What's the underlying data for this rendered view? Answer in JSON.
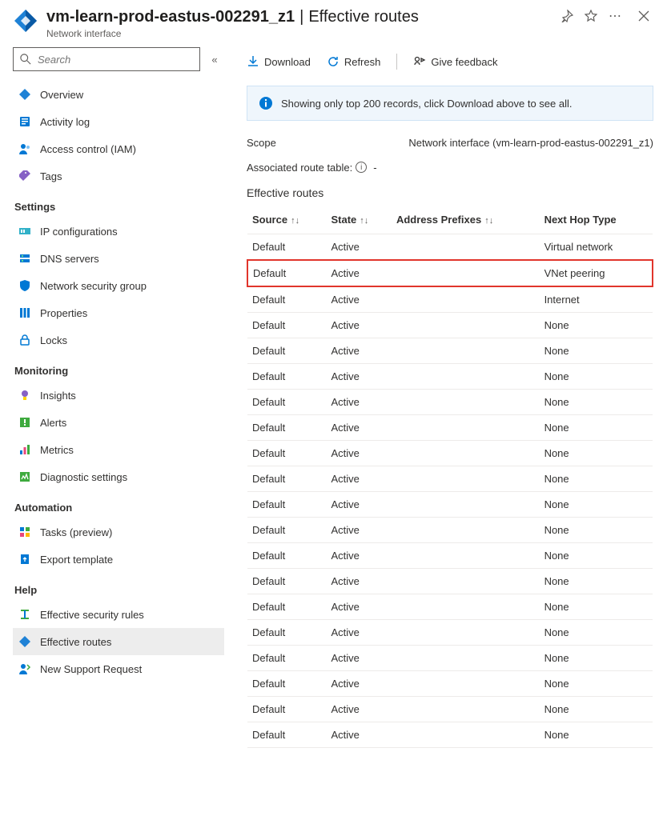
{
  "header": {
    "resource_name": "vm-learn-prod-eastus-002291_z1",
    "page_title": "Effective routes",
    "subtitle": "Network interface"
  },
  "sidebar": {
    "search_placeholder": "Search",
    "groups": [
      {
        "label": null,
        "items": [
          {
            "label": "Overview",
            "icon": "overview-icon"
          },
          {
            "label": "Activity log",
            "icon": "activity-log-icon"
          },
          {
            "label": "Access control (IAM)",
            "icon": "access-control-icon"
          },
          {
            "label": "Tags",
            "icon": "tags-icon"
          }
        ]
      },
      {
        "label": "Settings",
        "items": [
          {
            "label": "IP configurations",
            "icon": "ip-config-icon"
          },
          {
            "label": "DNS servers",
            "icon": "dns-icon"
          },
          {
            "label": "Network security group",
            "icon": "nsg-icon"
          },
          {
            "label": "Properties",
            "icon": "properties-icon"
          },
          {
            "label": "Locks",
            "icon": "locks-icon"
          }
        ]
      },
      {
        "label": "Monitoring",
        "items": [
          {
            "label": "Insights",
            "icon": "insights-icon"
          },
          {
            "label": "Alerts",
            "icon": "alerts-icon"
          },
          {
            "label": "Metrics",
            "icon": "metrics-icon"
          },
          {
            "label": "Diagnostic settings",
            "icon": "diagnostic-icon"
          }
        ]
      },
      {
        "label": "Automation",
        "items": [
          {
            "label": "Tasks (preview)",
            "icon": "tasks-icon"
          },
          {
            "label": "Export template",
            "icon": "export-template-icon"
          }
        ]
      },
      {
        "label": "Help",
        "items": [
          {
            "label": "Effective security rules",
            "icon": "eff-sec-rules-icon"
          },
          {
            "label": "Effective routes",
            "icon": "eff-routes-icon",
            "active": true
          },
          {
            "label": "New Support Request",
            "icon": "support-icon"
          }
        ]
      }
    ]
  },
  "toolbar": {
    "download": "Download",
    "refresh": "Refresh",
    "feedback": "Give feedback"
  },
  "banner": {
    "text": "Showing only top 200 records, click Download above to see all."
  },
  "scope": {
    "label": "Scope",
    "value": "Network interface (vm-learn-prod-eastus-002291_z1)"
  },
  "assoc": {
    "label": "Associated route table:",
    "value": "-"
  },
  "routes_title": "Effective routes",
  "columns": {
    "source": "Source",
    "state": "State",
    "prefixes": "Address Prefixes",
    "next_hop": "Next Hop Type"
  },
  "routes": [
    {
      "source": "Default",
      "state": "Active",
      "prefixes": "",
      "next_hop": "Virtual network",
      "hl": false
    },
    {
      "source": "Default",
      "state": "Active",
      "prefixes": "",
      "next_hop": "VNet peering",
      "hl": true
    },
    {
      "source": "Default",
      "state": "Active",
      "prefixes": "",
      "next_hop": "Internet",
      "hl": false
    },
    {
      "source": "Default",
      "state": "Active",
      "prefixes": "",
      "next_hop": "None",
      "hl": false
    },
    {
      "source": "Default",
      "state": "Active",
      "prefixes": "",
      "next_hop": "None",
      "hl": false
    },
    {
      "source": "Default",
      "state": "Active",
      "prefixes": "",
      "next_hop": "None",
      "hl": false
    },
    {
      "source": "Default",
      "state": "Active",
      "prefixes": "",
      "next_hop": "None",
      "hl": false
    },
    {
      "source": "Default",
      "state": "Active",
      "prefixes": "",
      "next_hop": "None",
      "hl": false
    },
    {
      "source": "Default",
      "state": "Active",
      "prefixes": "",
      "next_hop": "None",
      "hl": false
    },
    {
      "source": "Default",
      "state": "Active",
      "prefixes": "",
      "next_hop": "None",
      "hl": false
    },
    {
      "source": "Default",
      "state": "Active",
      "prefixes": "",
      "next_hop": "None",
      "hl": false
    },
    {
      "source": "Default",
      "state": "Active",
      "prefixes": "",
      "next_hop": "None",
      "hl": false
    },
    {
      "source": "Default",
      "state": "Active",
      "prefixes": "",
      "next_hop": "None",
      "hl": false
    },
    {
      "source": "Default",
      "state": "Active",
      "prefixes": "",
      "next_hop": "None",
      "hl": false
    },
    {
      "source": "Default",
      "state": "Active",
      "prefixes": "",
      "next_hop": "None",
      "hl": false
    },
    {
      "source": "Default",
      "state": "Active",
      "prefixes": "",
      "next_hop": "None",
      "hl": false
    },
    {
      "source": "Default",
      "state": "Active",
      "prefixes": "",
      "next_hop": "None",
      "hl": false
    },
    {
      "source": "Default",
      "state": "Active",
      "prefixes": "",
      "next_hop": "None",
      "hl": false
    },
    {
      "source": "Default",
      "state": "Active",
      "prefixes": "",
      "next_hop": "None",
      "hl": false
    },
    {
      "source": "Default",
      "state": "Active",
      "prefixes": "",
      "next_hop": "None",
      "hl": false
    }
  ]
}
